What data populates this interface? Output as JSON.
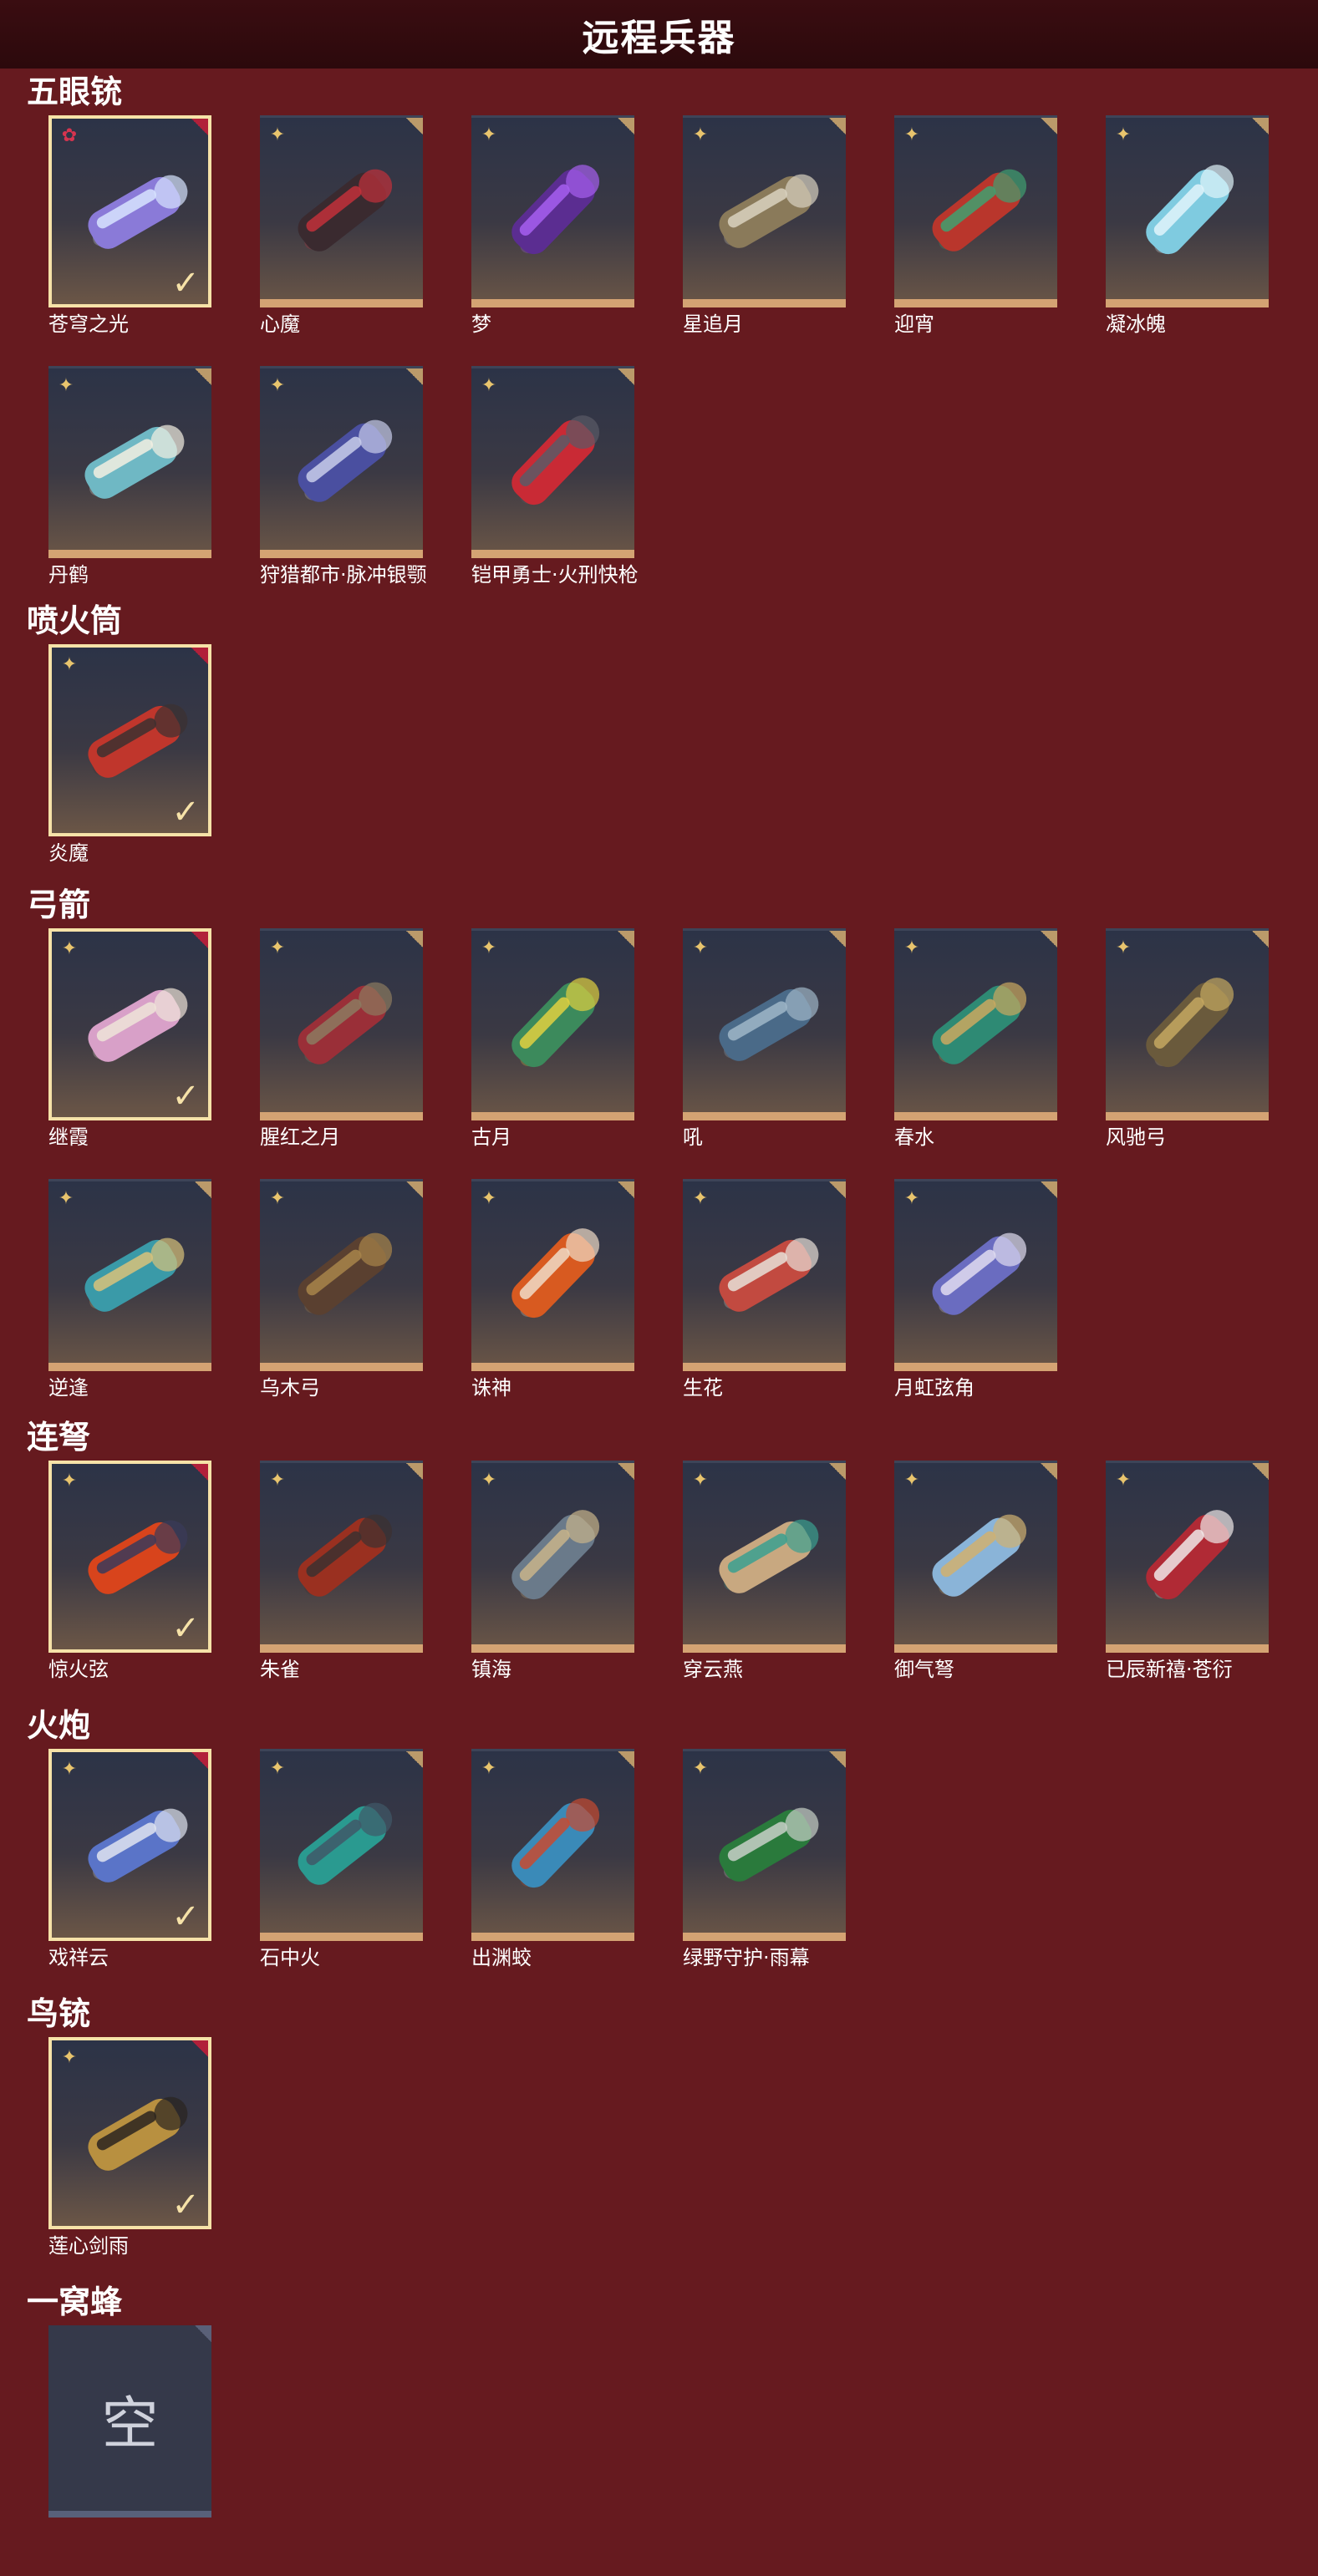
{
  "header": {
    "title": "远程兵器"
  },
  "colors": {
    "background": "#661a1f",
    "header": "#2c090c",
    "selected_border": "#f6e2a8",
    "bottom_strip": "#d4a373",
    "rarity_gold": "#e8c46d",
    "rarity_red": "#d6344f"
  },
  "icons": {
    "selected_mark": "checkmark-icon",
    "rarity_mark": "sparkle-icon",
    "corner_mark": "corner-tab-icon"
  },
  "sections": [
    {
      "title": "五眼铳",
      "items": [
        {
          "name": "苍穹之光",
          "selected": true,
          "rarity": "red",
          "hue": "#8a7ad8",
          "hue2": "#d7e4ff"
        },
        {
          "name": "心魔",
          "selected": false,
          "rarity": "gold",
          "hue": "#3a2a2f",
          "hue2": "#c2303a"
        },
        {
          "name": "梦",
          "selected": false,
          "rarity": "gold",
          "hue": "#5b2d91",
          "hue2": "#a75ff0"
        },
        {
          "name": "星追月",
          "selected": false,
          "rarity": "gold",
          "hue": "#8a7a5a",
          "hue2": "#d9d2c0"
        },
        {
          "name": "迎宵",
          "selected": false,
          "rarity": "gold",
          "hue": "#b9362c",
          "hue2": "#40a070"
        },
        {
          "name": "凝冰魄",
          "selected": false,
          "rarity": "gold",
          "hue": "#7fcbe0",
          "hue2": "#e0f4fa"
        },
        {
          "name": "丹鹤",
          "selected": false,
          "rarity": "gold",
          "hue": "#6fb8c4",
          "hue2": "#f3efe2"
        },
        {
          "name": "狩猎都市·脉冲银颚",
          "selected": false,
          "rarity": "gold",
          "hue": "#4a4fa0",
          "hue2": "#c8ccea"
        },
        {
          "name": "铠甲勇士·火刑快枪",
          "selected": false,
          "rarity": "gold",
          "hue": "#c92a35",
          "hue2": "#5a5a66"
        }
      ]
    },
    {
      "title": "喷火筒",
      "items": [
        {
          "name": "炎魔",
          "selected": true,
          "rarity": "gold",
          "hue": "#c0362c",
          "hue2": "#3c3030"
        }
      ]
    },
    {
      "title": "弓箭",
      "items": [
        {
          "name": "继霞",
          "selected": true,
          "rarity": "gold",
          "hue": "#d8a0c8",
          "hue2": "#efe4d8"
        },
        {
          "name": "腥红之月",
          "selected": false,
          "rarity": "gold",
          "hue": "#9a2f38",
          "hue2": "#8c7a60"
        },
        {
          "name": "古月",
          "selected": false,
          "rarity": "gold",
          "hue": "#3c8a5c",
          "hue2": "#e0d040"
        },
        {
          "name": "吼",
          "selected": false,
          "rarity": "gold",
          "hue": "#4a6a88",
          "hue2": "#9fb6c8"
        },
        {
          "name": "春水",
          "selected": false,
          "rarity": "gold",
          "hue": "#2e8a74",
          "hue2": "#caa860"
        },
        {
          "name": "风驰弓",
          "selected": false,
          "rarity": "gold",
          "hue": "#6a5a3c",
          "hue2": "#c4a860"
        },
        {
          "name": "逆逢",
          "selected": false,
          "rarity": "gold",
          "hue": "#3a9aa8",
          "hue2": "#d9c27a"
        },
        {
          "name": "乌木弓",
          "selected": false,
          "rarity": "gold",
          "hue": "#5a4030",
          "hue2": "#a8854a"
        },
        {
          "name": "诛神",
          "selected": false,
          "rarity": "gold",
          "hue": "#d85a20",
          "hue2": "#f0dcc8"
        },
        {
          "name": "生花",
          "selected": false,
          "rarity": "gold",
          "hue": "#c24a40",
          "hue2": "#e8e0d8"
        },
        {
          "name": "月虹弦角",
          "selected": false,
          "rarity": "gold",
          "hue": "#6a6cc0",
          "hue2": "#e0dcf0"
        }
      ]
    },
    {
      "title": "连弩",
      "items": [
        {
          "name": "惊火弦",
          "selected": true,
          "rarity": "gold",
          "hue": "#d8441c",
          "hue2": "#3a3a5a"
        },
        {
          "name": "朱雀",
          "selected": false,
          "rarity": "gold",
          "hue": "#9a3020",
          "hue2": "#3c3030"
        },
        {
          "name": "镇海",
          "selected": false,
          "rarity": "gold",
          "hue": "#6a7a8a",
          "hue2": "#c8b48a"
        },
        {
          "name": "穿云燕",
          "selected": false,
          "rarity": "gold",
          "hue": "#c8a880",
          "hue2": "#3aa090"
        },
        {
          "name": "御气弩",
          "selected": false,
          "rarity": "gold",
          "hue": "#8ab4d8",
          "hue2": "#d0b070"
        },
        {
          "name": "已辰新禧·苍衍",
          "selected": false,
          "rarity": "gold",
          "hue": "#b02a35",
          "hue2": "#f0e8e8"
        }
      ]
    },
    {
      "title": "火炮",
      "items": [
        {
          "name": "戏祥云",
          "selected": true,
          "rarity": "gold",
          "hue": "#5a74c8",
          "hue2": "#e0e4f0"
        },
        {
          "name": "石中火",
          "selected": false,
          "rarity": "gold",
          "hue": "#2a9a90",
          "hue2": "#405868"
        },
        {
          "name": "出渊蛟",
          "selected": false,
          "rarity": "gold",
          "hue": "#3a8ab8",
          "hue2": "#c84a30"
        },
        {
          "name": "绿野守护·雨幕",
          "selected": false,
          "rarity": "gold",
          "hue": "#2a7a3c",
          "hue2": "#c8d0c8"
        }
      ]
    },
    {
      "title": "鸟铳",
      "items": [
        {
          "name": "莲心剑雨",
          "selected": true,
          "rarity": "gold",
          "hue": "#b89040",
          "hue2": "#2a2420"
        }
      ]
    },
    {
      "title": "一窝蜂",
      "empty": true,
      "empty_text": "空",
      "items": []
    }
  ]
}
